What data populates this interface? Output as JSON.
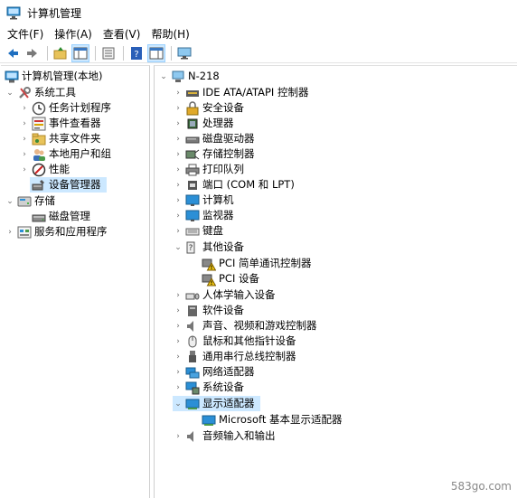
{
  "window": {
    "title": "计算机管理"
  },
  "menu": {
    "file": "文件(F)",
    "action": "操作(A)",
    "view": "查看(V)",
    "help": "帮助(H)"
  },
  "toolbar": {
    "buttons": [
      "back-icon",
      "forward-icon",
      "up-folder-icon",
      "show-hide-tree-icon",
      "properties-icon",
      "help-icon",
      "action-pane-icon",
      "computer-icon"
    ]
  },
  "left_tree": {
    "root": "计算机管理(本地)",
    "system_tools": "系统工具",
    "task_scheduler": "任务计划程序",
    "event_viewer": "事件查看器",
    "shared_folders": "共享文件夹",
    "local_users": "本地用户和组",
    "performance": "性能",
    "device_manager": "设备管理器",
    "storage": "存储",
    "disk_management": "磁盘管理",
    "services_apps": "服务和应用程序"
  },
  "device_tree": {
    "computer_name": "N-218",
    "categories": {
      "ide": "IDE ATA/ATAPI 控制器",
      "security": "安全设备",
      "processors": "处理器",
      "disk_drives": "磁盘驱动器",
      "storage_controllers": "存储控制器",
      "print_queues": "打印队列",
      "ports": "端口 (COM 和 LPT)",
      "computer": "计算机",
      "monitors": "监视器",
      "keyboards": "键盘",
      "other_devices": "其他设备",
      "pci_simple_comm": "PCI 简单通讯控制器",
      "pci_device": "PCI 设备",
      "hid": "人体学输入设备",
      "software_devices": "软件设备",
      "sound": "声音、视频和游戏控制器",
      "mice": "鼠标和其他指针设备",
      "usb": "通用串行总线控制器",
      "network": "网络适配器",
      "system_devices": "系统设备",
      "display_adapters": "显示适配器",
      "ms_basic_display": "Microsoft 基本显示适配器",
      "audio_io": "音频输入和输出"
    }
  },
  "watermark": "583go.com",
  "colors": {
    "selection": "#cce8ff",
    "warning": "#f2c811",
    "monitor": "#2b8fd6"
  }
}
